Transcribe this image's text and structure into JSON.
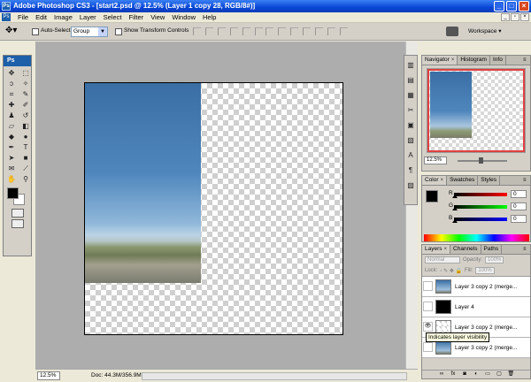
{
  "window": {
    "title": "Adobe Photoshop CS3 - [start2.psd @ 12.5% (Layer 1 copy 28, RGB/8#)]",
    "app_icon": "Ps"
  },
  "menu": {
    "items": [
      "File",
      "Edit",
      "Image",
      "Layer",
      "Select",
      "Filter",
      "View",
      "Window",
      "Help"
    ]
  },
  "options": {
    "auto_select_label": "Auto-Select:",
    "auto_select_value": "Group",
    "transform_label": "Show Transform Controls",
    "workspace_label": "Workspace ▾"
  },
  "toolbox": {
    "logo": "Ps"
  },
  "status": {
    "zoom": "12.5%",
    "doc": "Doc: 44.3M/356.9M"
  },
  "navigator": {
    "tabs": [
      "Navigator",
      "Histogram",
      "Info"
    ],
    "zoom": "12.5%"
  },
  "color_panel": {
    "tabs": [
      "Color",
      "Swatches",
      "Styles"
    ],
    "channels": [
      {
        "label": "R",
        "value": "0",
        "color": "#c00000"
      },
      {
        "label": "G",
        "value": "0",
        "color": "#00a000"
      },
      {
        "label": "B",
        "value": "0",
        "color": "#0000c0"
      }
    ]
  },
  "layers_panel": {
    "tabs": [
      "Layers",
      "Channels",
      "Paths"
    ],
    "blend_mode": "Normal",
    "opacity_label": "Opacity:",
    "opacity_value": "100%",
    "lock_label": "Lock:",
    "fill_label": "Fill:",
    "fill_value": "100%",
    "layers": [
      {
        "name": "Layer 3 copy 2 (merge...",
        "thumb": "sky",
        "visible": false
      },
      {
        "name": "Layer 4",
        "thumb": "black",
        "visible": false
      },
      {
        "name": "Layer 3 copy 2 (merge...",
        "thumb": "checker",
        "visible": true
      },
      {
        "name": "Layer 3 copy 2 (merge...",
        "thumb": "sky",
        "visible": false
      }
    ],
    "tooltip": "Indicates layer visibility"
  }
}
